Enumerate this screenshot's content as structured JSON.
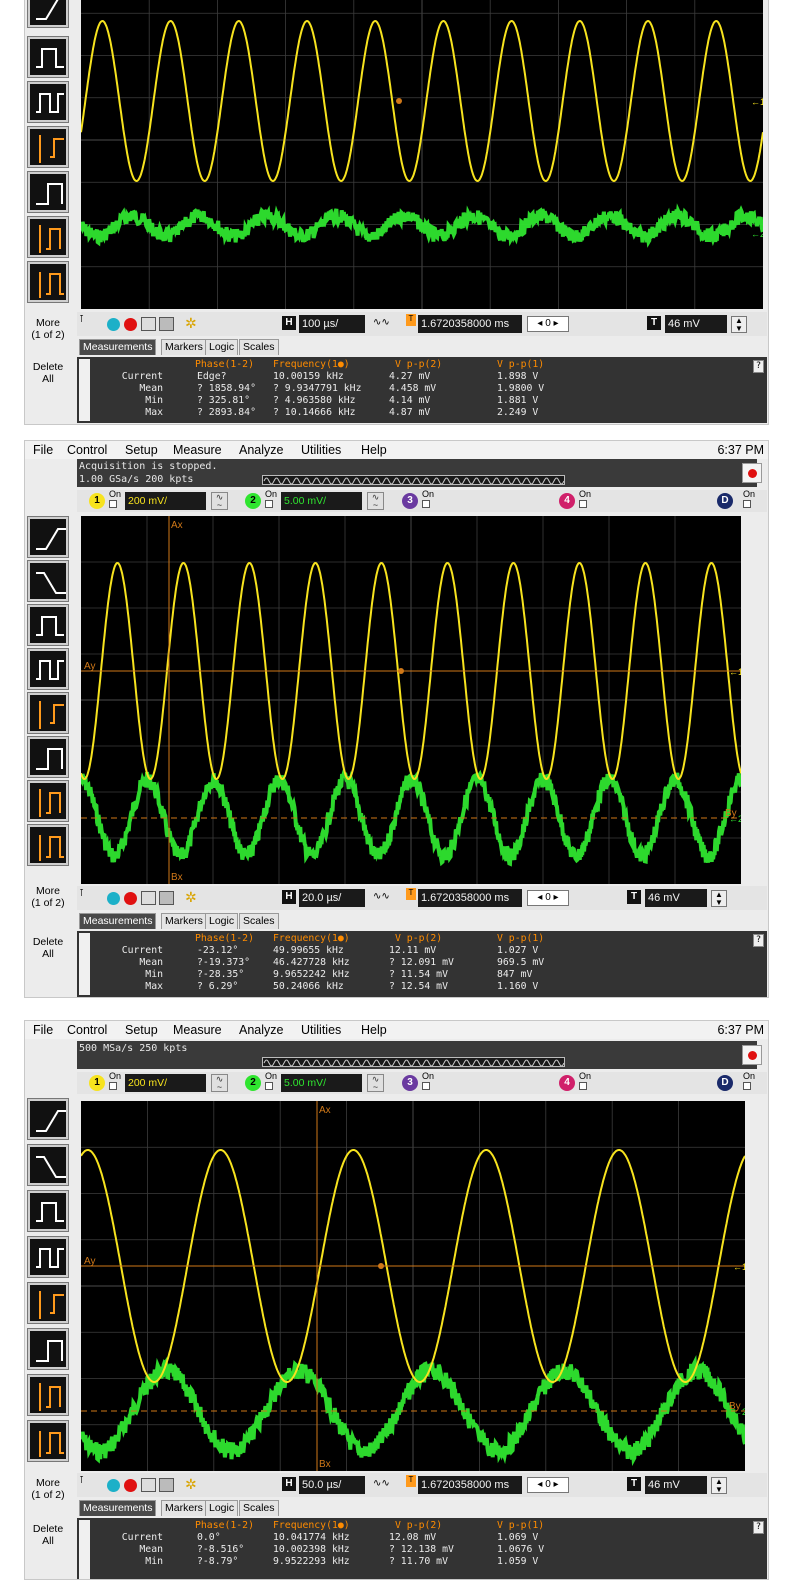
{
  "menu": [
    "File",
    "Control",
    "Setup",
    "Measure",
    "Analyze",
    "Utilities",
    "Help"
  ],
  "clock": "6:37 PM",
  "common": {
    "ch1_scale": "200 mV/",
    "ch2_scale": "5.00 mV/",
    "on_label": "On",
    "trigger_level": "46 mV",
    "delay": "1.6720358000 ms",
    "position_box": "0",
    "more_label": "More\n(1 of 2)",
    "delete_label": "Delete\nAll",
    "tabs": [
      "Measurements",
      "Markers",
      "Logic",
      "Scales"
    ],
    "colors": {
      "ch1": "#f7e31e",
      "ch2": "#2fe52f",
      "marker": "#d07818",
      "grid": "#3c3c3c",
      "accent_orange": "#ff8c00"
    }
  },
  "screens": [
    {
      "status_line1": "",
      "status_line2": "",
      "timebase": "100 µs/",
      "headers": {
        "phase": "Phase(1-2)",
        "freq": "Frequency(1●)",
        "vpp2": "V p-p(2)",
        "vpp1": "V p-p(1)"
      },
      "rows": [
        {
          "label": "Current",
          "phase": "Edge?",
          "freq": "10.00159 kHz",
          "vpp2": "4.27 mV",
          "vpp1": "1.898 V"
        },
        {
          "label": "Mean",
          "phase": "? 1858.94°",
          "freq": "? 9.9347791 kHz",
          "vpp2": "4.458 mV",
          "vpp1": "1.9800 V"
        },
        {
          "label": "Min",
          "phase": "? 325.81°",
          "freq": "? 4.963580 kHz",
          "vpp2": "4.14 mV",
          "vpp1": "1.881 V"
        },
        {
          "label": "Max",
          "phase": "? 2893.84°",
          "freq": "? 10.14666 kHz",
          "vpp2": "4.87 mV",
          "vpp1": "2.249 V"
        }
      ],
      "waves": {
        "ch1_cycles": 10,
        "ch2_cycles": 10
      }
    },
    {
      "status_line1": "Acquisition is stopped.",
      "status_line2": "1.00 GSa/s   200 kpts",
      "timebase": "20.0 µs/",
      "markers": {
        "ax": "Ax",
        "bx": "Bx",
        "ay": "Ay",
        "by": "By"
      },
      "headers": {
        "phase": "Phase(1-2)",
        "freq": "Frequency(1●)",
        "vpp2": "V p-p(2)",
        "vpp1": "V p-p(1)"
      },
      "rows": [
        {
          "label": "Current",
          "phase": "-23.12°",
          "freq": "49.99655 kHz",
          "vpp2": "12.11 mV",
          "vpp1": "1.027 V"
        },
        {
          "label": "Mean",
          "phase": "?-19.373°",
          "freq": "46.427728 kHz",
          "vpp2": "? 12.091 mV",
          "vpp1": "969.5 mV"
        },
        {
          "label": "Min",
          "phase": "?-28.35°",
          "freq": "9.9652242 kHz",
          "vpp2": "? 11.54 mV",
          "vpp1": "847 mV"
        },
        {
          "label": "Max",
          "phase": "? 6.29°",
          "freq": "50.24066 kHz",
          "vpp2": "? 12.54 mV",
          "vpp1": "1.160 V"
        }
      ],
      "waves": {
        "ch1_cycles": 10,
        "ch2_cycles": 10
      }
    },
    {
      "status_line1": "",
      "status_line2": "500 MSa/s   250 kpts",
      "timebase": "50.0 µs/",
      "markers": {
        "ax": "Ax",
        "bx": "Bx",
        "ay": "Ay",
        "by": "By"
      },
      "headers": {
        "phase": "Phase(1-2)",
        "freq": "Frequency(1●)",
        "vpp2": "V p-p(2)",
        "vpp1": "V p-p(1)"
      },
      "rows": [
        {
          "label": "Current",
          "phase": "0.0°",
          "freq": "10.041774 kHz",
          "vpp2": "12.08 mV",
          "vpp1": "1.069 V"
        },
        {
          "label": "Mean",
          "phase": "?-8.516°",
          "freq": "10.002398 kHz",
          "vpp2": "? 12.138 mV",
          "vpp1": "1.0676 V"
        },
        {
          "label": "Min",
          "phase": "?-8.79°",
          "freq": "9.9522293 kHz",
          "vpp2": "? 11.70 mV",
          "vpp1": "1.059 V"
        }
      ],
      "waves": {
        "ch1_cycles": 5,
        "ch2_cycles": 5
      }
    }
  ]
}
